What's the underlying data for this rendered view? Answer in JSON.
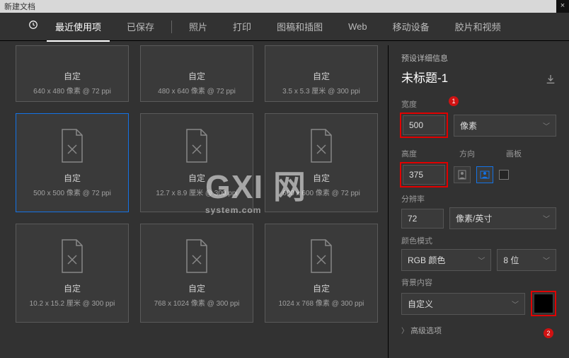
{
  "window": {
    "title": "新建文档",
    "close": "×"
  },
  "tabs": {
    "recent": "最近使用项",
    "saved": "已保存",
    "photo": "照片",
    "print": "打印",
    "art": "图稿和插图",
    "web": "Web",
    "mobile": "移动设备",
    "film": "胶片和视频"
  },
  "presets": {
    "row0": [
      {
        "title": "自定",
        "sub": "640 x 480 像素 @ 72 ppi"
      },
      {
        "title": "自定",
        "sub": "480 x 640 像素 @ 72 ppi"
      },
      {
        "title": "自定",
        "sub": "3.5 x 5.3 厘米 @ 300 ppi"
      }
    ],
    "row1": [
      {
        "title": "自定",
        "sub": "500 x 500 像素 @ 72 ppi"
      },
      {
        "title": "自定",
        "sub": "12.7 x 8.9 厘米 @ 300 ppi"
      },
      {
        "title": "自定",
        "sub": "600 x 600 像素 @ 72 ppi"
      }
    ],
    "row2": [
      {
        "title": "自定",
        "sub": "10.2 x 15.2 厘米 @ 300 ppi"
      },
      {
        "title": "自定",
        "sub": "768 x 1024 像素 @ 300 ppi"
      },
      {
        "title": "自定",
        "sub": "1024 x 768 像素 @ 300 ppi"
      }
    ]
  },
  "panel": {
    "header": "预设详细信息",
    "doc_title": "未标题-1",
    "width_label": "宽度",
    "width_value": "500",
    "width_unit": "像素",
    "height_label": "高度",
    "orient_label": "方向",
    "artboard_label": "画板",
    "height_value": "375",
    "res_label": "分辨率",
    "res_value": "72",
    "res_unit": "像素/英寸",
    "color_label": "颜色模式",
    "color_mode": "RGB 颜色",
    "bit_depth": "8 位",
    "bg_label": "背景内容",
    "bg_value": "自定义",
    "advanced": "高级选项",
    "badge1": "1",
    "badge2": "2"
  },
  "watermark": {
    "main": "GXI 网",
    "sub": "system.com"
  }
}
